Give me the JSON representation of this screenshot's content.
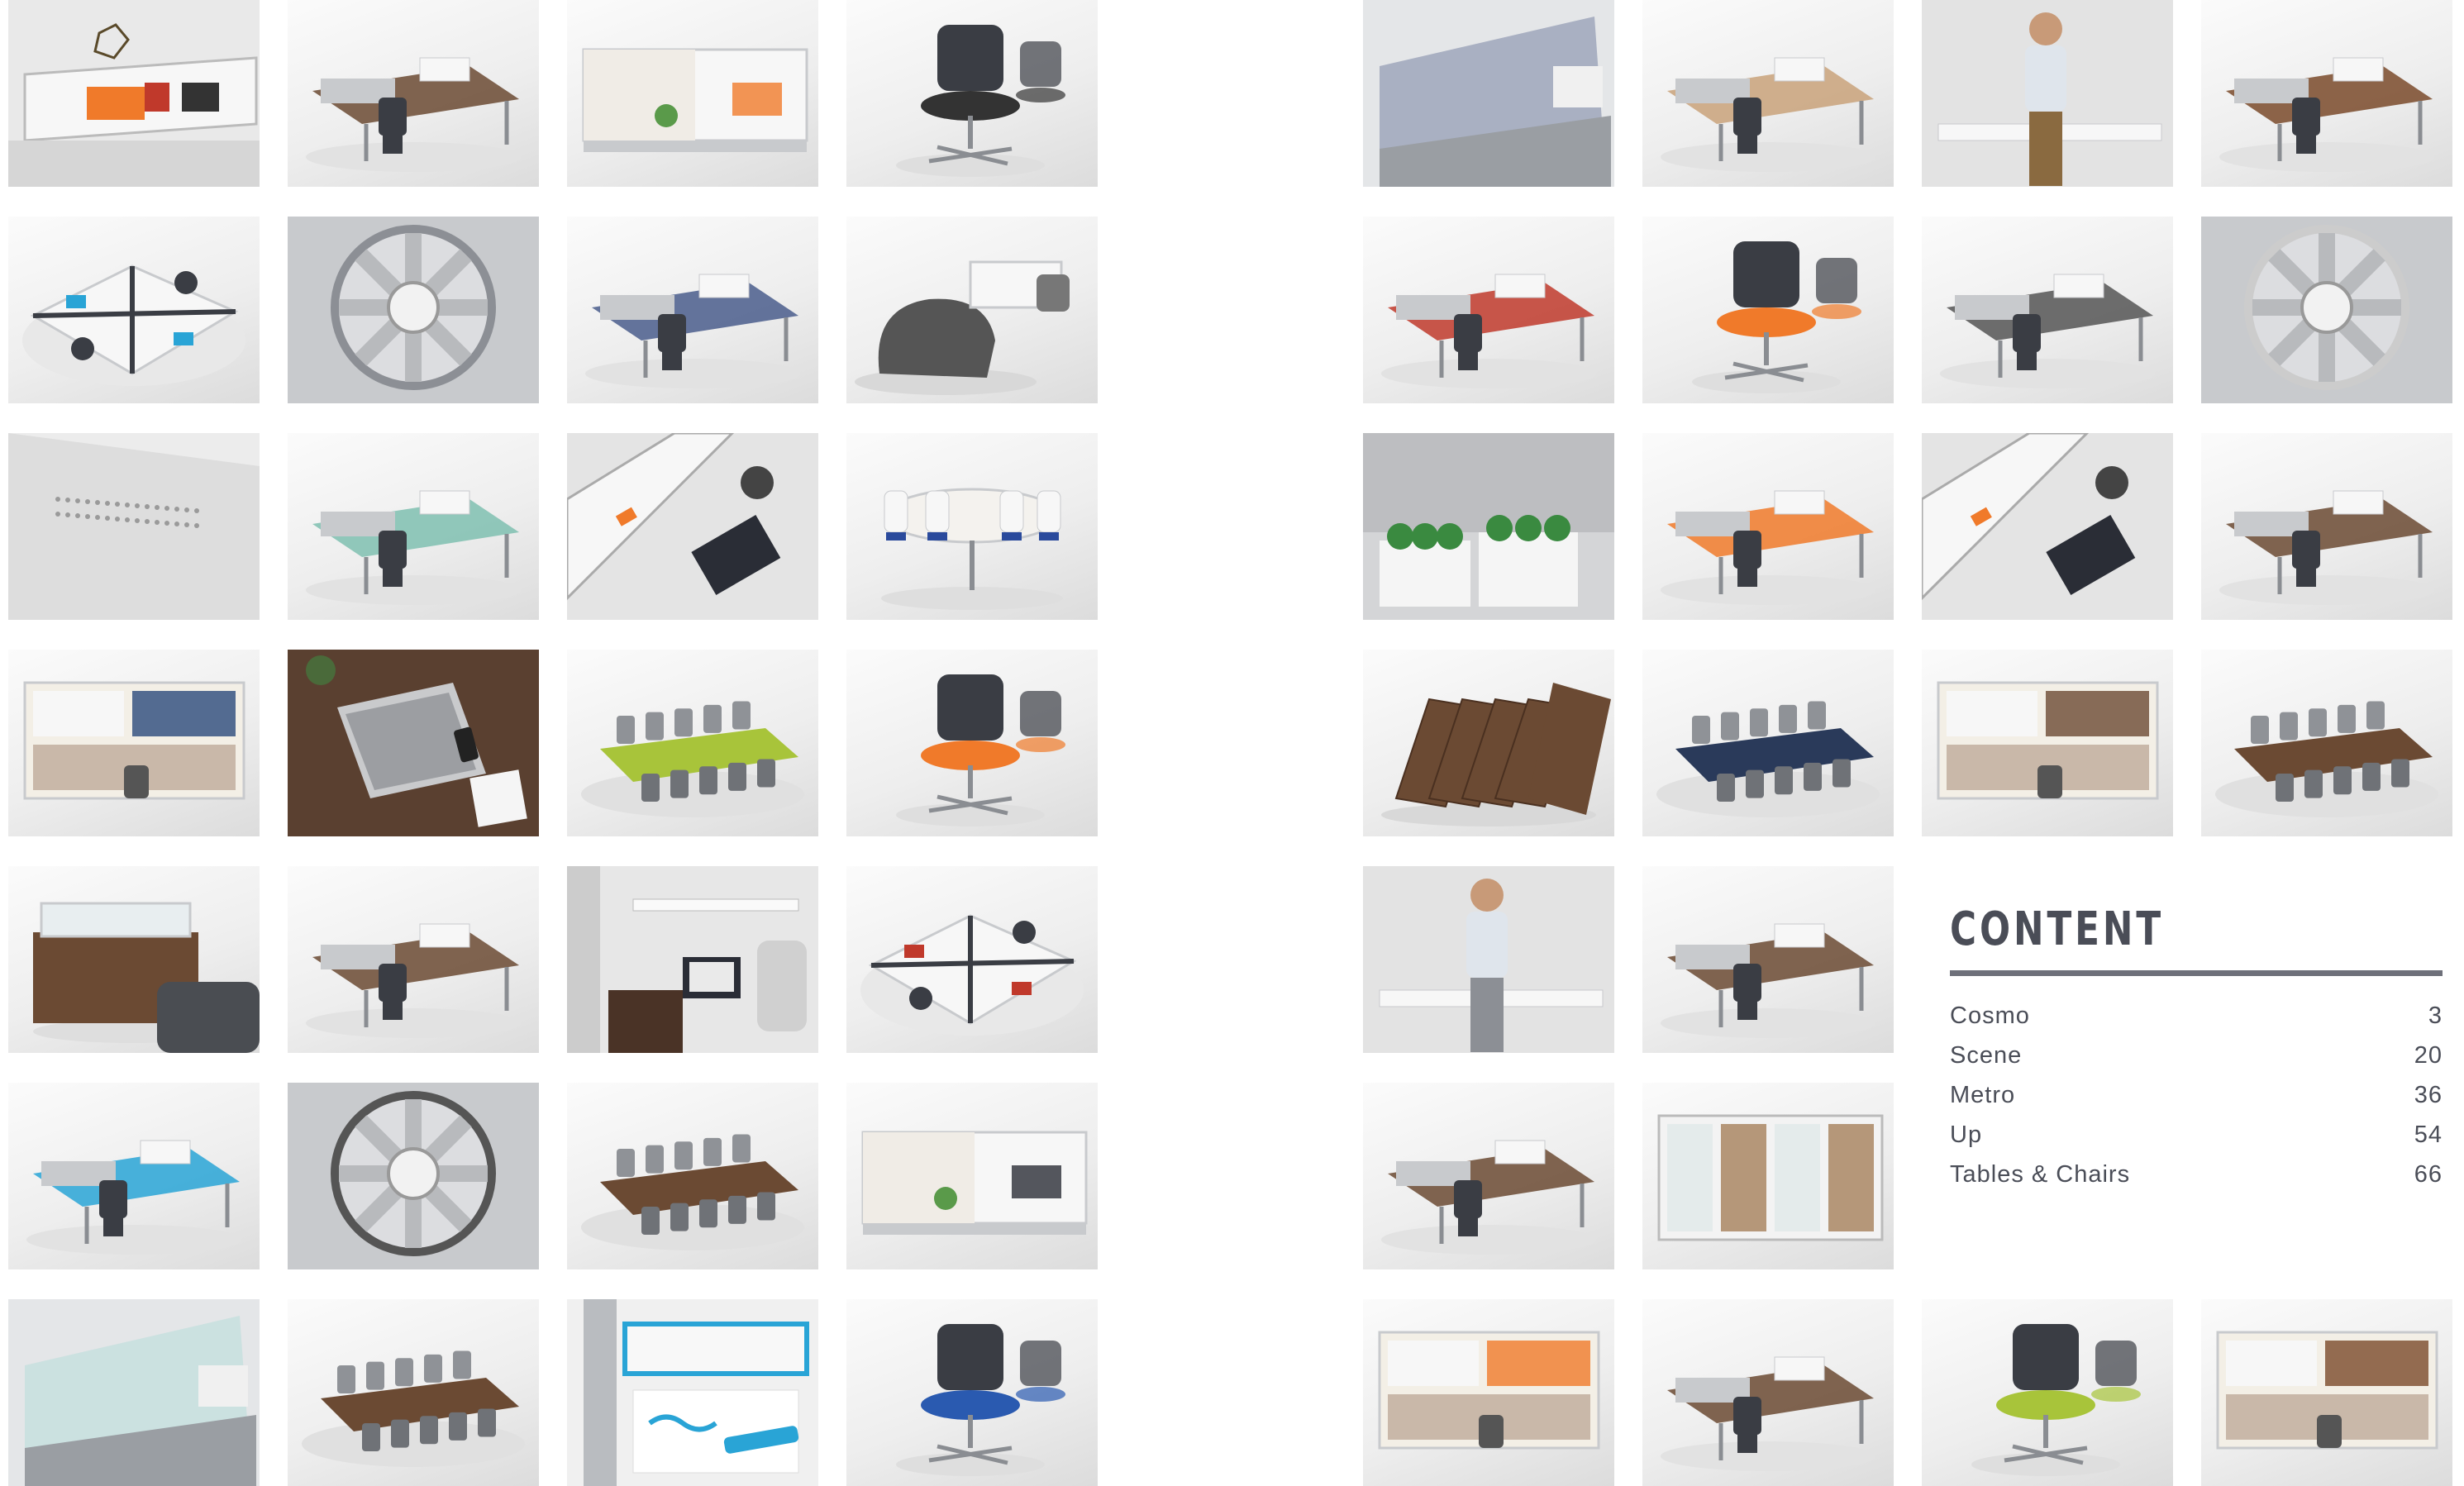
{
  "content": {
    "heading": "CONTENT",
    "entries": [
      {
        "title": "Cosmo",
        "page": "3"
      },
      {
        "title": "Scene",
        "page": "20"
      },
      {
        "title": "Metro",
        "page": "36"
      },
      {
        "title": "Up",
        "page": "54"
      },
      {
        "title": "Tables & Chairs",
        "page": "66"
      }
    ]
  },
  "photo_grid": {
    "left_tiles": [
      {
        "variant": "shelf",
        "accent": "#f07a2a"
      },
      {
        "variant": "desk",
        "accent": "#6b4a33"
      },
      {
        "variant": "panel",
        "accent": "#f07a2a"
      },
      {
        "variant": "chair",
        "accent": "#333333"
      },
      {
        "variant": "cluster",
        "accent": "#29a4d6"
      },
      {
        "variant": "detail",
        "accent": "#8c8f95"
      },
      {
        "variant": "desk",
        "accent": "#4a5d8c"
      },
      {
        "variant": "lounge",
        "accent": "#555555"
      },
      {
        "variant": "wall",
        "accent": "#bbbbbb"
      },
      {
        "variant": "desk",
        "accent": "#7fbfb0"
      },
      {
        "variant": "aerial",
        "accent": "#f07a2a"
      },
      {
        "variant": "table",
        "accent": "#2a4a9c"
      },
      {
        "variant": "storage",
        "accent": "#2a4a7c"
      },
      {
        "variant": "laptop",
        "accent": "#5a4030"
      },
      {
        "variant": "meeting",
        "accent": "#a8c43a"
      },
      {
        "variant": "chair",
        "accent": "#f07a2a"
      },
      {
        "variant": "reception",
        "accent": "#6b4a33"
      },
      {
        "variant": "desk",
        "accent": "#6b4a33"
      },
      {
        "variant": "workstation",
        "accent": "#333333"
      },
      {
        "variant": "cluster",
        "accent": "#c0392b"
      },
      {
        "variant": "desk",
        "accent": "#29a4d6"
      },
      {
        "variant": "detail",
        "accent": "#555555"
      },
      {
        "variant": "meeting",
        "accent": "#6b4a33"
      },
      {
        "variant": "panel",
        "accent": "#2a2d36"
      },
      {
        "variant": "glass",
        "accent": "#9fd8d0"
      },
      {
        "variant": "meeting",
        "accent": "#6b4a33"
      },
      {
        "variant": "sign",
        "accent": "#29a4d6"
      },
      {
        "variant": "chair",
        "accent": "#2a5ab0"
      }
    ],
    "right_tiles": [
      {
        "variant": "glass",
        "accent": "#3b4a7a"
      },
      {
        "variant": "desk",
        "accent": "#c9a27a"
      },
      {
        "variant": "person",
        "accent": "#8a6a40"
      },
      {
        "variant": "desk",
        "accent": "#7a4a2a"
      },
      {
        "variant": "desk",
        "accent": "#c0392b"
      },
      {
        "variant": "chair",
        "accent": "#f07a2a"
      },
      {
        "variant": "desk",
        "accent": "#555555"
      },
      {
        "variant": "detail",
        "accent": "#cccccc"
      },
      {
        "variant": "planter",
        "accent": "#3a8a40"
      },
      {
        "variant": "desk",
        "accent": "#f07a2a"
      },
      {
        "variant": "aerial",
        "accent": "#f07a2a"
      },
      {
        "variant": "desk",
        "accent": "#6b4a33"
      },
      {
        "variant": "tables",
        "accent": "#6b4a33"
      },
      {
        "variant": "meeting",
        "accent": "#2a3a5a"
      },
      {
        "variant": "storage",
        "accent": "#6b4a33"
      },
      {
        "variant": "meeting",
        "accent": "#6b4a33"
      },
      {
        "variant": "person",
        "accent": "#8c8f95"
      },
      {
        "variant": "desk",
        "accent": "#6b4a33"
      },
      {
        "variant": "empty",
        "accent": "#ffffff"
      },
      {
        "variant": "empty",
        "accent": "#ffffff"
      },
      {
        "variant": "desk",
        "accent": "#6b4a33"
      },
      {
        "variant": "room",
        "accent": "#a07850"
      },
      {
        "variant": "empty",
        "accent": "#ffffff"
      },
      {
        "variant": "empty",
        "accent": "#ffffff"
      },
      {
        "variant": "storage",
        "accent": "#f07a2a"
      },
      {
        "variant": "desk",
        "accent": "#6b4a33"
      },
      {
        "variant": "chair",
        "accent": "#a8c43a"
      },
      {
        "variant": "storage",
        "accent": "#7a4a2a"
      }
    ]
  }
}
